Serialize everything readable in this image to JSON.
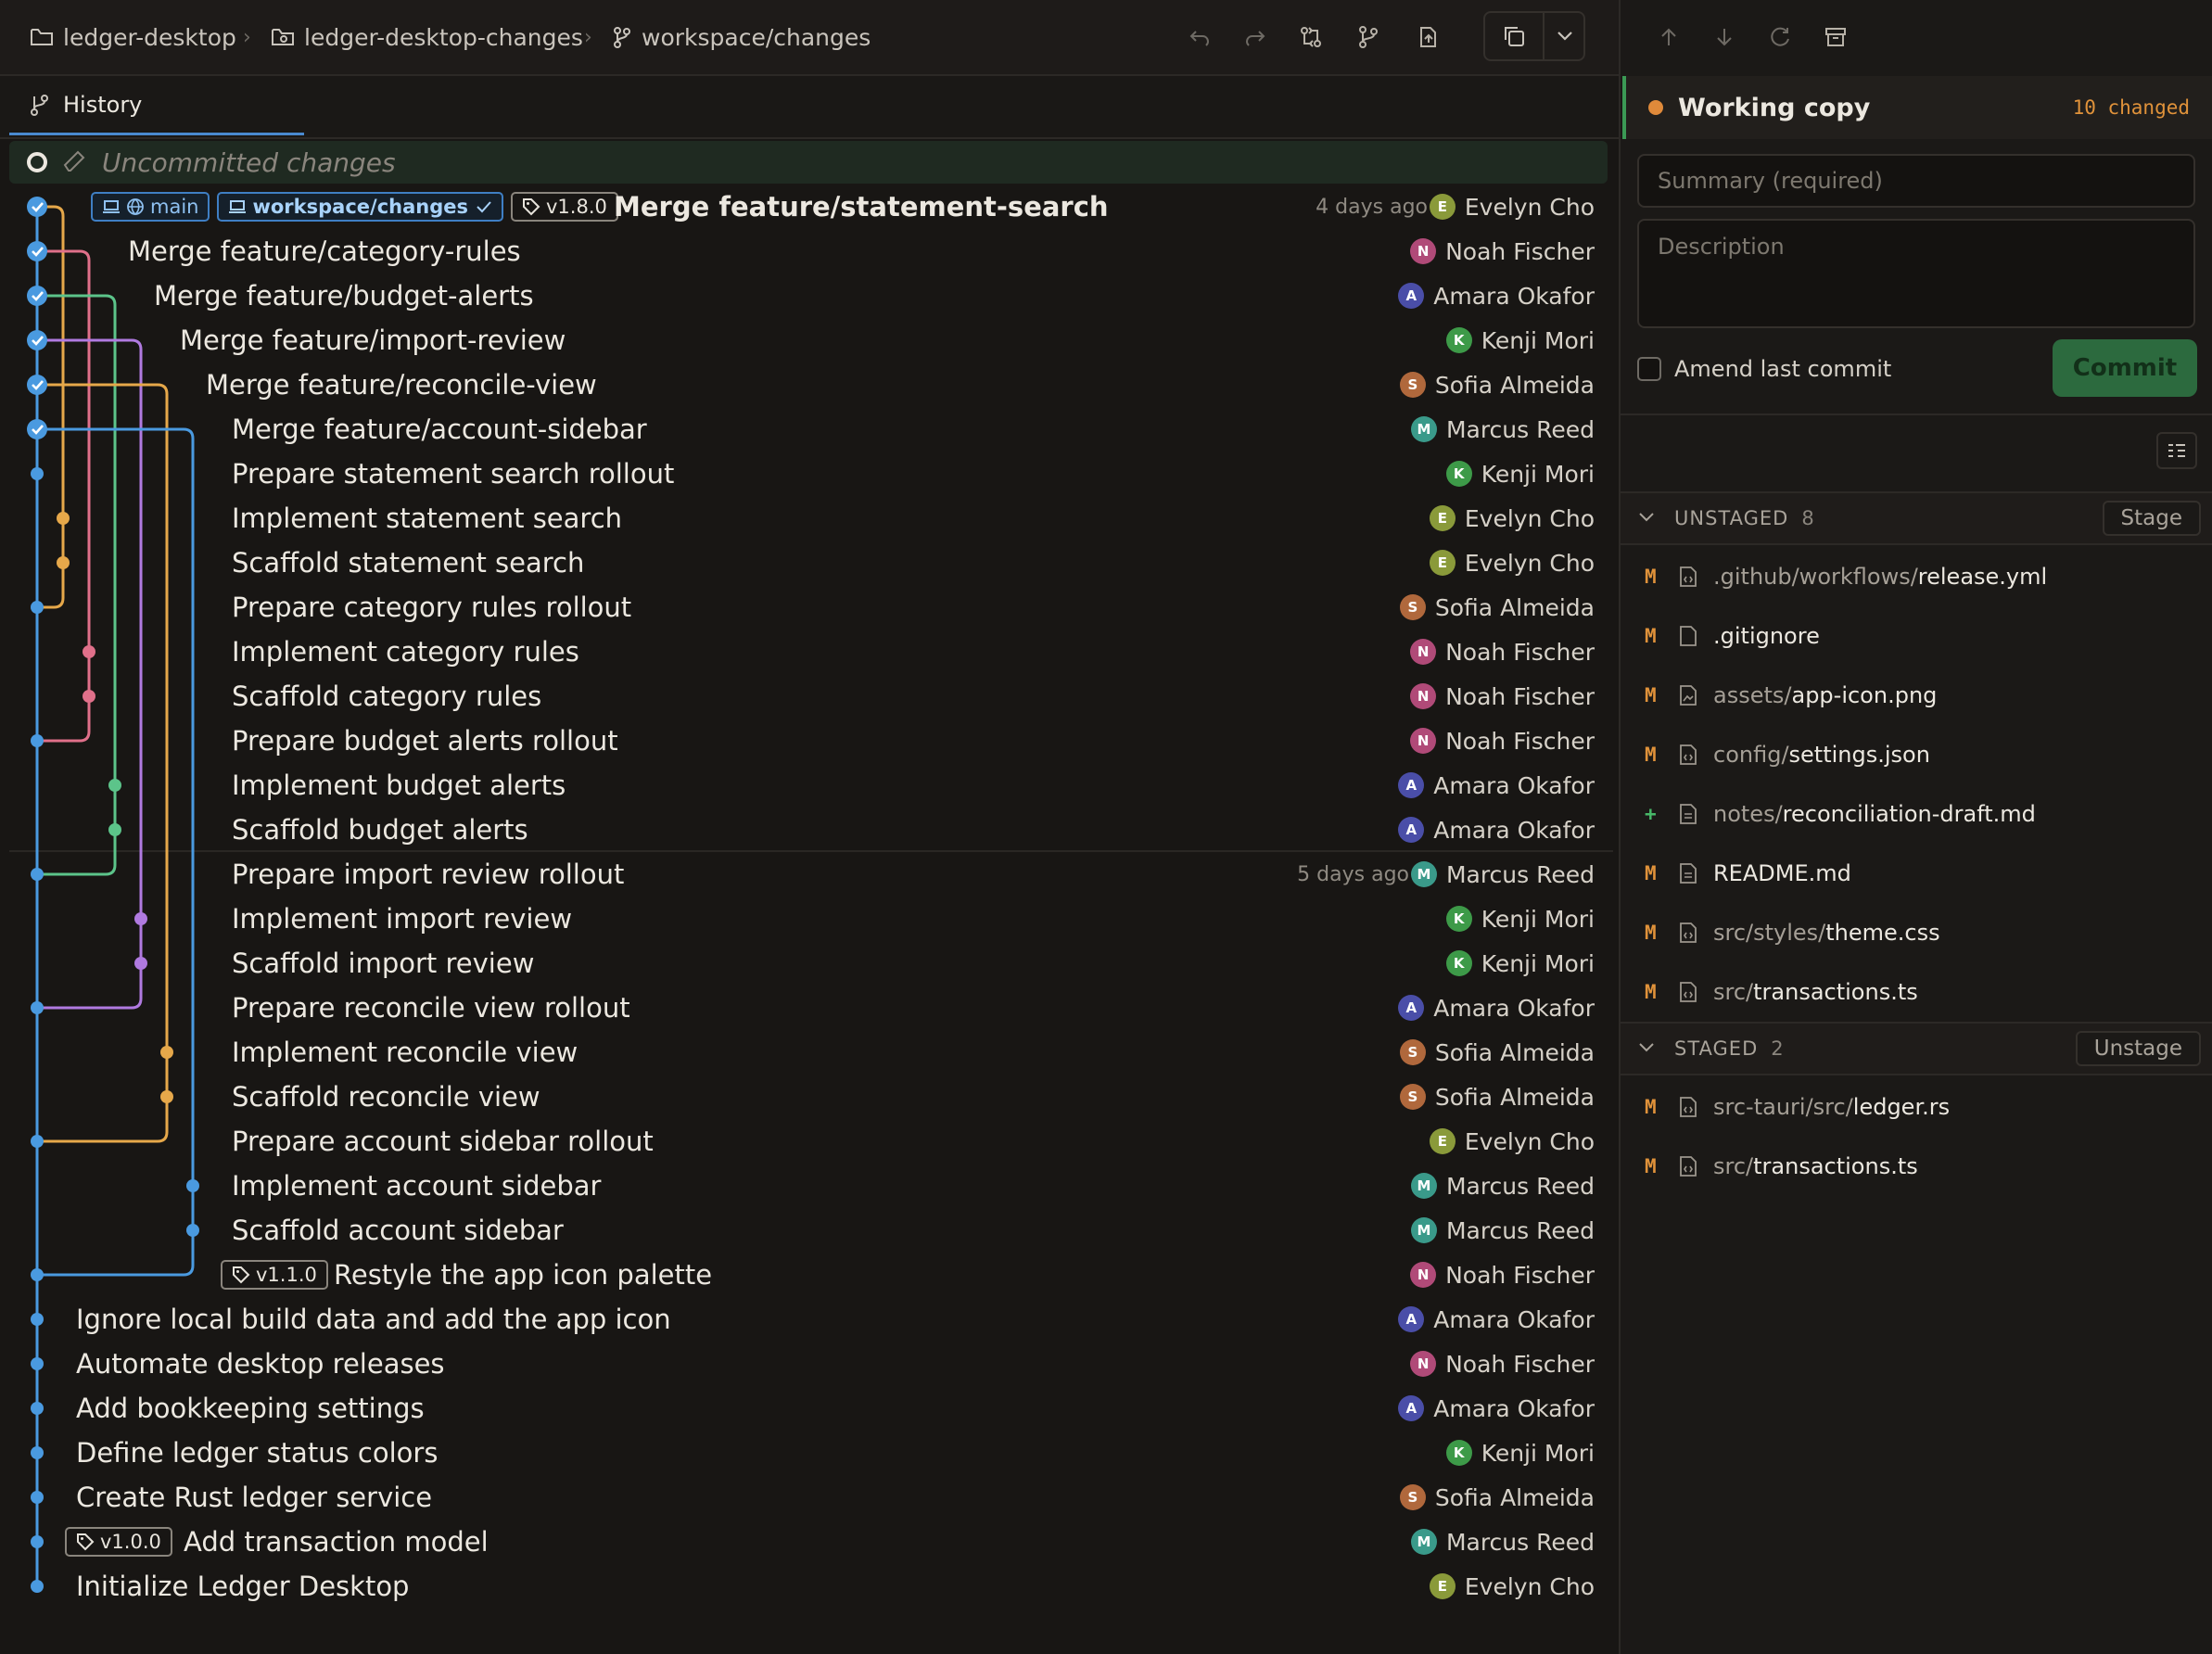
{
  "breadcrumb": [
    {
      "label": "ledger-desktop",
      "icon": "folder-icon"
    },
    {
      "label": "ledger-desktop-changes",
      "icon": "folder-tree-icon"
    },
    {
      "label": "workspace/changes",
      "icon": "branch-icon"
    }
  ],
  "toolbar": {
    "buttons": [
      "undo-icon",
      "redo-icon",
      "compare-icon",
      "branch-icon",
      "stash-icon",
      "copy-icon",
      "chevron-down-icon"
    ]
  },
  "tabs": [
    {
      "label": "History",
      "active": true
    }
  ],
  "history": {
    "uncommitted_label": "Uncommitted changes",
    "lane_colors": [
      "#4a9ae0",
      "#e0708a",
      "#5cc48a",
      "#b07ae0",
      "#e6a84a",
      "#4a9ae0"
    ],
    "commits": [
      {
        "message": "Merge feature/statement-search",
        "author": "Evelyn Cho",
        "time": "4 days ago",
        "refs": [
          {
            "type": "branch",
            "label": "main"
          },
          {
            "type": "branch",
            "label": "workspace/changes",
            "current": true
          },
          {
            "type": "tag",
            "label": "v1.8.0"
          }
        ],
        "bold": true
      },
      {
        "message": "Merge feature/category-rules",
        "author": "Noah Fischer"
      },
      {
        "message": "Merge feature/budget-alerts",
        "author": "Amara Okafor"
      },
      {
        "message": "Merge feature/import-review",
        "author": "Kenji Mori"
      },
      {
        "message": "Merge feature/reconcile-view",
        "author": "Sofia Almeida"
      },
      {
        "message": "Merge feature/account-sidebar",
        "author": "Marcus Reed"
      },
      {
        "message": "Prepare statement search rollout",
        "author": "Kenji Mori"
      },
      {
        "message": "Implement statement search",
        "author": "Evelyn Cho"
      },
      {
        "message": "Scaffold statement search",
        "author": "Evelyn Cho"
      },
      {
        "message": "Prepare category rules rollout",
        "author": "Sofia Almeida"
      },
      {
        "message": "Implement category rules",
        "author": "Noah Fischer"
      },
      {
        "message": "Scaffold category rules",
        "author": "Noah Fischer"
      },
      {
        "message": "Prepare budget alerts rollout",
        "author": "Noah Fischer"
      },
      {
        "message": "Implement budget alerts",
        "author": "Amara Okafor"
      },
      {
        "message": "Scaffold budget alerts",
        "author": "Amara Okafor"
      },
      {
        "message": "Prepare import review rollout",
        "author": "Marcus Reed",
        "time": "5 days ago"
      },
      {
        "message": "Implement import review",
        "author": "Kenji Mori"
      },
      {
        "message": "Scaffold import review",
        "author": "Kenji Mori"
      },
      {
        "message": "Prepare reconcile view rollout",
        "author": "Amara Okafor"
      },
      {
        "message": "Implement reconcile view",
        "author": "Sofia Almeida"
      },
      {
        "message": "Scaffold reconcile view",
        "author": "Sofia Almeida"
      },
      {
        "message": "Prepare account sidebar rollout",
        "author": "Evelyn Cho"
      },
      {
        "message": "Implement account sidebar",
        "author": "Marcus Reed"
      },
      {
        "message": "Scaffold account sidebar",
        "author": "Marcus Reed"
      },
      {
        "message": "Restyle the app icon palette",
        "author": "Noah Fischer",
        "refs": [
          {
            "type": "tag",
            "label": "v1.1.0"
          }
        ]
      },
      {
        "message": "Ignore local build data and add the app icon",
        "author": "Amara Okafor"
      },
      {
        "message": "Automate desktop releases",
        "author": "Noah Fischer"
      },
      {
        "message": "Add bookkeeping settings",
        "author": "Amara Okafor"
      },
      {
        "message": "Define ledger status colors",
        "author": "Kenji Mori"
      },
      {
        "message": "Create Rust ledger service",
        "author": "Sofia Almeida"
      },
      {
        "message": "Add transaction model",
        "author": "Marcus Reed",
        "refs": [
          {
            "type": "tag",
            "label": "v1.0.0"
          }
        ]
      },
      {
        "message": "Initialize Ledger Desktop",
        "author": "Evelyn Cho"
      }
    ]
  },
  "author_colors": {
    "Evelyn Cho": "#8a9a3a",
    "Noah Fischer": "#b04a78",
    "Amara Okafor": "#4a4ea8",
    "Kenji Mori": "#3d9a48",
    "Sofia Almeida": "#b0683c",
    "Marcus Reed": "#3a9a8a"
  },
  "working_copy": {
    "label": "Working copy",
    "changed": "10 changed",
    "summary_placeholder": "Summary (required)",
    "description_placeholder": "Description",
    "amend_label": "Amend last commit",
    "commit_label": "Commit"
  },
  "unstaged": {
    "title": "UNSTAGED",
    "count": "8",
    "action": "Stage",
    "files": [
      {
        "status": "M",
        "dir": ".github/workflows/",
        "name": "release.yml",
        "icon": "file-code-icon"
      },
      {
        "status": "M",
        "dir": "",
        "name": ".gitignore",
        "icon": "file-icon"
      },
      {
        "status": "M",
        "dir": "assets/",
        "name": "app-icon.png",
        "icon": "file-image-icon"
      },
      {
        "status": "M",
        "dir": "config/",
        "name": "settings.json",
        "icon": "file-code-icon"
      },
      {
        "status": "+",
        "dir": "notes/",
        "name": "reconciliation-draft.md",
        "icon": "file-text-icon"
      },
      {
        "status": "M",
        "dir": "",
        "name": "README.md",
        "icon": "file-text-icon"
      },
      {
        "status": "M",
        "dir": "src/styles/",
        "name": "theme.css",
        "icon": "file-code-icon"
      },
      {
        "status": "M",
        "dir": "src/",
        "name": "transactions.ts",
        "icon": "file-code-icon"
      }
    ]
  },
  "staged": {
    "title": "STAGED",
    "count": "2",
    "action": "Unstage",
    "files": [
      {
        "status": "M",
        "dir": "src-tauri/src/",
        "name": "ledger.rs",
        "icon": "file-code-icon"
      },
      {
        "status": "M",
        "dir": "src/",
        "name": "transactions.ts",
        "icon": "file-code-icon"
      }
    ]
  }
}
